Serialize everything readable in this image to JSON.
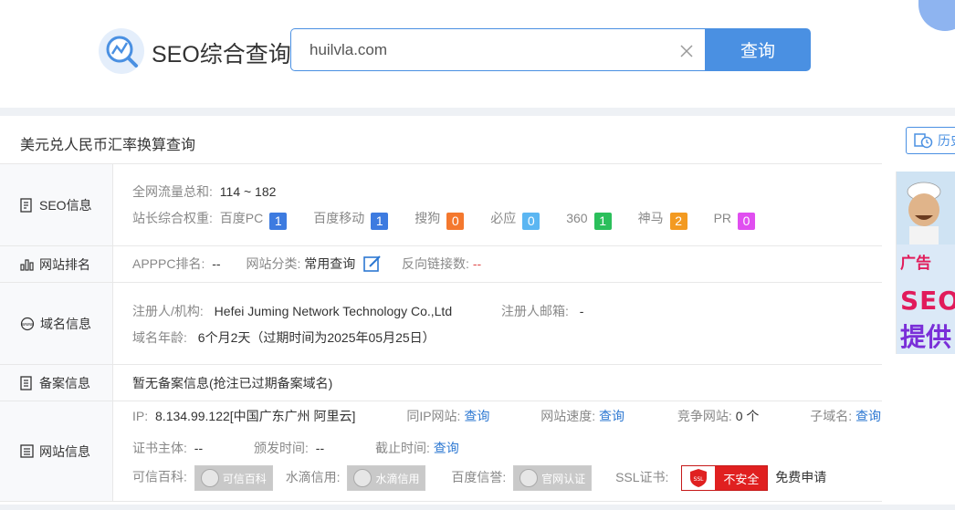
{
  "header": {
    "brand": "SEO综合查询",
    "search_value": "huilvla.com",
    "search_button": "查询"
  },
  "panel": {
    "title": "美元兑人民币汇率换算查询",
    "history_label": "历史"
  },
  "seo": {
    "label": "SEO信息",
    "traffic_label": "全网流量总和:",
    "traffic_value": "114 ~ 182",
    "weight_label": "站长综合权重:",
    "weights": [
      {
        "name": "百度PC",
        "value": "1",
        "color": "#3d7be0"
      },
      {
        "name": "百度移动",
        "value": "1",
        "color": "#3d7be0"
      },
      {
        "name": "搜狗",
        "value": "0",
        "color": "#f4782e"
      },
      {
        "name": "必应",
        "value": "0",
        "color": "#5bb6f2"
      },
      {
        "name": "360",
        "value": "1",
        "color": "#2bbf5b"
      },
      {
        "name": "神马",
        "value": "2",
        "color": "#f39a21"
      },
      {
        "name": "PR",
        "value": "0",
        "color": "#e04ef0"
      }
    ]
  },
  "rank": {
    "label": "网站排名",
    "apppc_label": "APPPC排名:",
    "apppc_value": "--",
    "category_label": "网站分类:",
    "category_value": "常用查询",
    "backlinks_label": "反向链接数:",
    "backlinks_value": "--"
  },
  "domain": {
    "label": "域名信息",
    "registrant_label": "注册人/机构:",
    "registrant_value": "Hefei Juming Network Technology Co.,Ltd",
    "email_label": "注册人邮箱:",
    "email_value": "-",
    "age_label": "域名年龄:",
    "age_value": "6个月2天（过期时间为2025年05月25日）"
  },
  "beian": {
    "label": "备案信息",
    "value": "暂无备案信息(抢注已过期备案域名)"
  },
  "site": {
    "label": "网站信息",
    "ip_label": "IP:",
    "ip_value": "8.134.99.122[中国广东广州 阿里云]",
    "same_ip_label": "同IP网站:",
    "same_ip_link": "查询",
    "speed_label": "网站速度:",
    "speed_link": "查询",
    "compete_label": "竞争网站:",
    "compete_value": "0 个",
    "subdomain_label": "子域名:",
    "subdomain_link": "查询",
    "cert_subject_label": "证书主体:",
    "cert_subject_value": "--",
    "issue_label": "颁发时间:",
    "issue_value": "--",
    "expire_label": "截止时间:",
    "expire_link": "查询",
    "kexin_label": "可信百科:",
    "kexin_badge": "可信百科",
    "shuidi_label": "水滴信用:",
    "shuidi_badge": "水滴信用",
    "baidu_label": "百度信誉:",
    "baidu_badge": "官网认证",
    "ssl_label": "SSL证书:",
    "ssl_badge_icon": "SSL",
    "ssl_status": "不安全",
    "ssl_free": "免费申请"
  },
  "ad": {
    "tag": "广告",
    "line1": "SEO",
    "line2": "提供"
  }
}
